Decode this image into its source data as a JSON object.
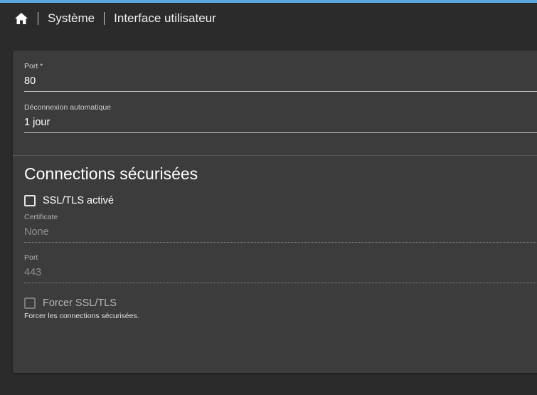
{
  "breadcrumb": {
    "home_icon": "home-icon",
    "items": [
      "Système",
      "Interface utilisateur"
    ]
  },
  "general": {
    "port": {
      "label": "Port *",
      "value": "80"
    },
    "auto_logout": {
      "label": "Déconnexion automatique",
      "value": "1 jour"
    }
  },
  "secure": {
    "title": "Connections sécurisées",
    "ssl_enabled": {
      "label": "SSL/TLS activé",
      "checked": false
    },
    "certificate": {
      "label": "Certificate",
      "value": "None"
    },
    "port": {
      "label": "Port",
      "value": "443"
    },
    "force_ssl": {
      "label": "Forcer SSL/TLS",
      "checked": false,
      "helper": "Forcer les connections sécurisées."
    }
  },
  "colors": {
    "accent": "#5aa7e0",
    "background": "#2b2b2b",
    "card": "#3c3c3c"
  }
}
